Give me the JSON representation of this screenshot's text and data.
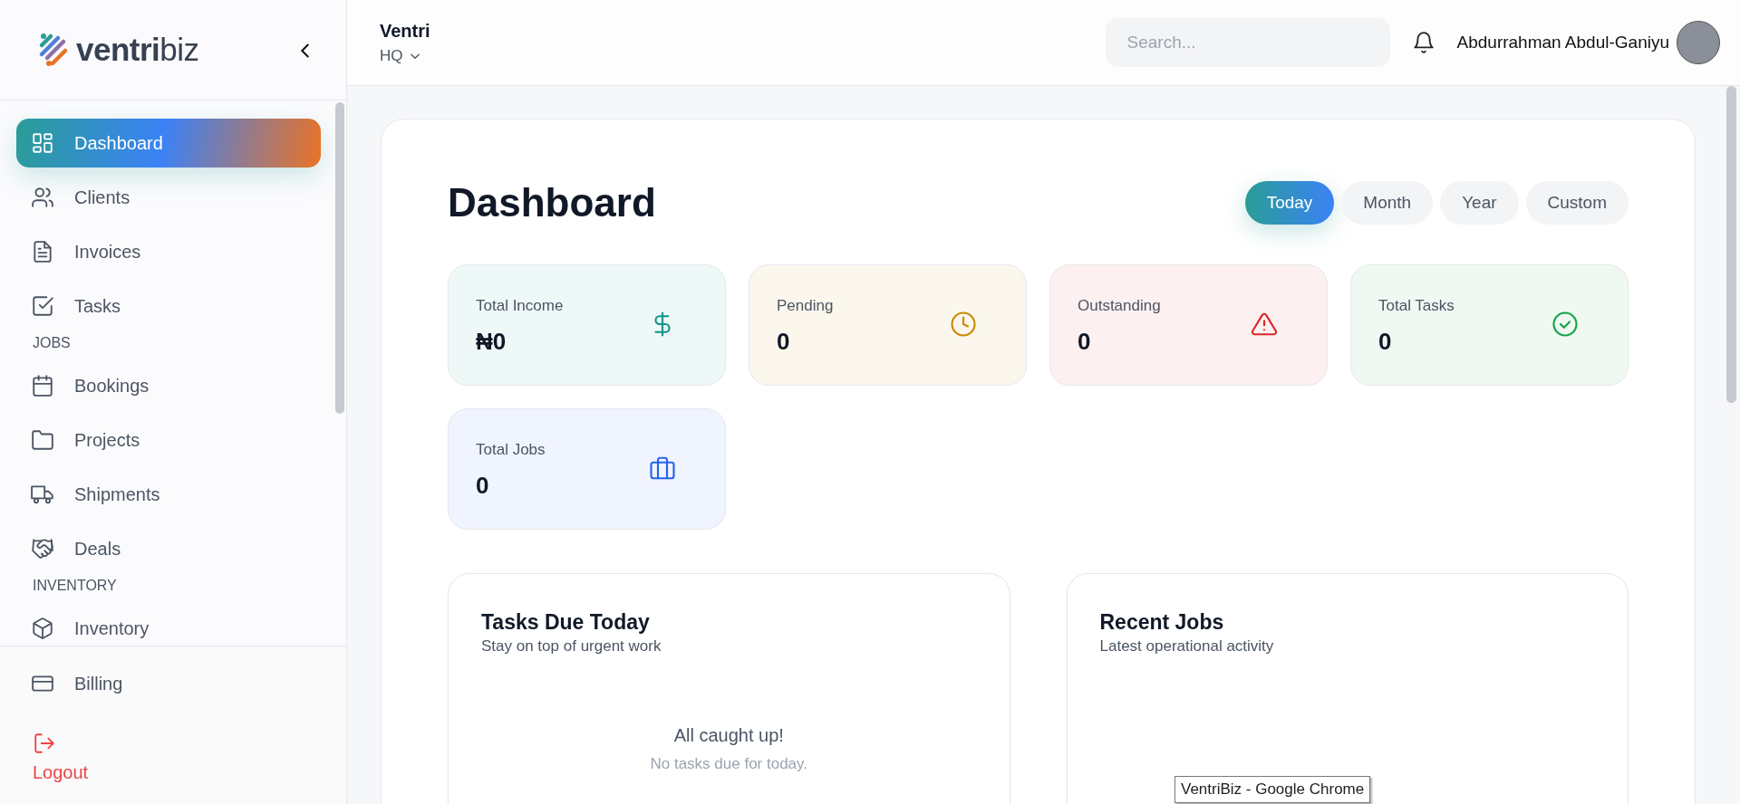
{
  "sidebar": {
    "logo": "**ventri**biz",
    "items": [
      {
        "kind": "link",
        "label": "Dashboard",
        "selected": true
      },
      {
        "kind": "link",
        "label": "Clients",
        "selected": false
      },
      {
        "kind": "link",
        "label": "Invoices",
        "selected": false
      },
      {
        "kind": "link",
        "label": "Tasks",
        "selected": false
      },
      {
        "kind": "section",
        "label": "JOBS"
      },
      {
        "kind": "link",
        "label": "Bookings",
        "selected": false
      },
      {
        "kind": "link",
        "label": "Projects",
        "selected": false
      },
      {
        "kind": "link",
        "label": "Shipments",
        "selected": false
      },
      {
        "kind": "link",
        "label": "Deals",
        "selected": false
      },
      {
        "kind": "section",
        "label": "INVENTORY"
      },
      {
        "kind": "link",
        "label": "Inventory",
        "selected": false
      }
    ],
    "footer": [
      {
        "kind": "link",
        "label": "Billing"
      },
      {
        "kind": "logout",
        "label": "Logout"
      }
    ]
  },
  "header": {
    "organization": "Ventri",
    "branch": "HQ",
    "search": {
      "placeholder": "Search..."
    },
    "user_name": "Abdurrahman Abdul-Ganiyu"
  },
  "page": {
    "title": "Dashboard",
    "periods": [
      {
        "label": "Today",
        "selected": true
      },
      {
        "label": "Month",
        "selected": false
      },
      {
        "label": "Year",
        "selected": false
      },
      {
        "label": "Custom",
        "selected": false
      }
    ],
    "stats": [
      {
        "label": "Total Income",
        "value": "₦0",
        "color": "#0d9488"
      },
      {
        "label": "Pending",
        "value": "0",
        "color": "#ca8a04"
      },
      {
        "label": "Outstanding",
        "value": "0",
        "color": "#dc2626"
      },
      {
        "label": "Total Tasks",
        "value": "0",
        "color": "#16a34a"
      },
      {
        "label": "Total Jobs",
        "value": "0",
        "color": "#2563eb"
      }
    ],
    "panels": [
      {
        "title": "Tasks Due Today",
        "subtitle": "Stay on top of urgent work",
        "empty_title": "All caught up!",
        "empty_text": "No tasks due for today."
      },
      {
        "title": "Recent Jobs",
        "subtitle": "Latest operational activity"
      }
    ]
  },
  "tooltip": "VentriBiz - Google Chrome"
}
